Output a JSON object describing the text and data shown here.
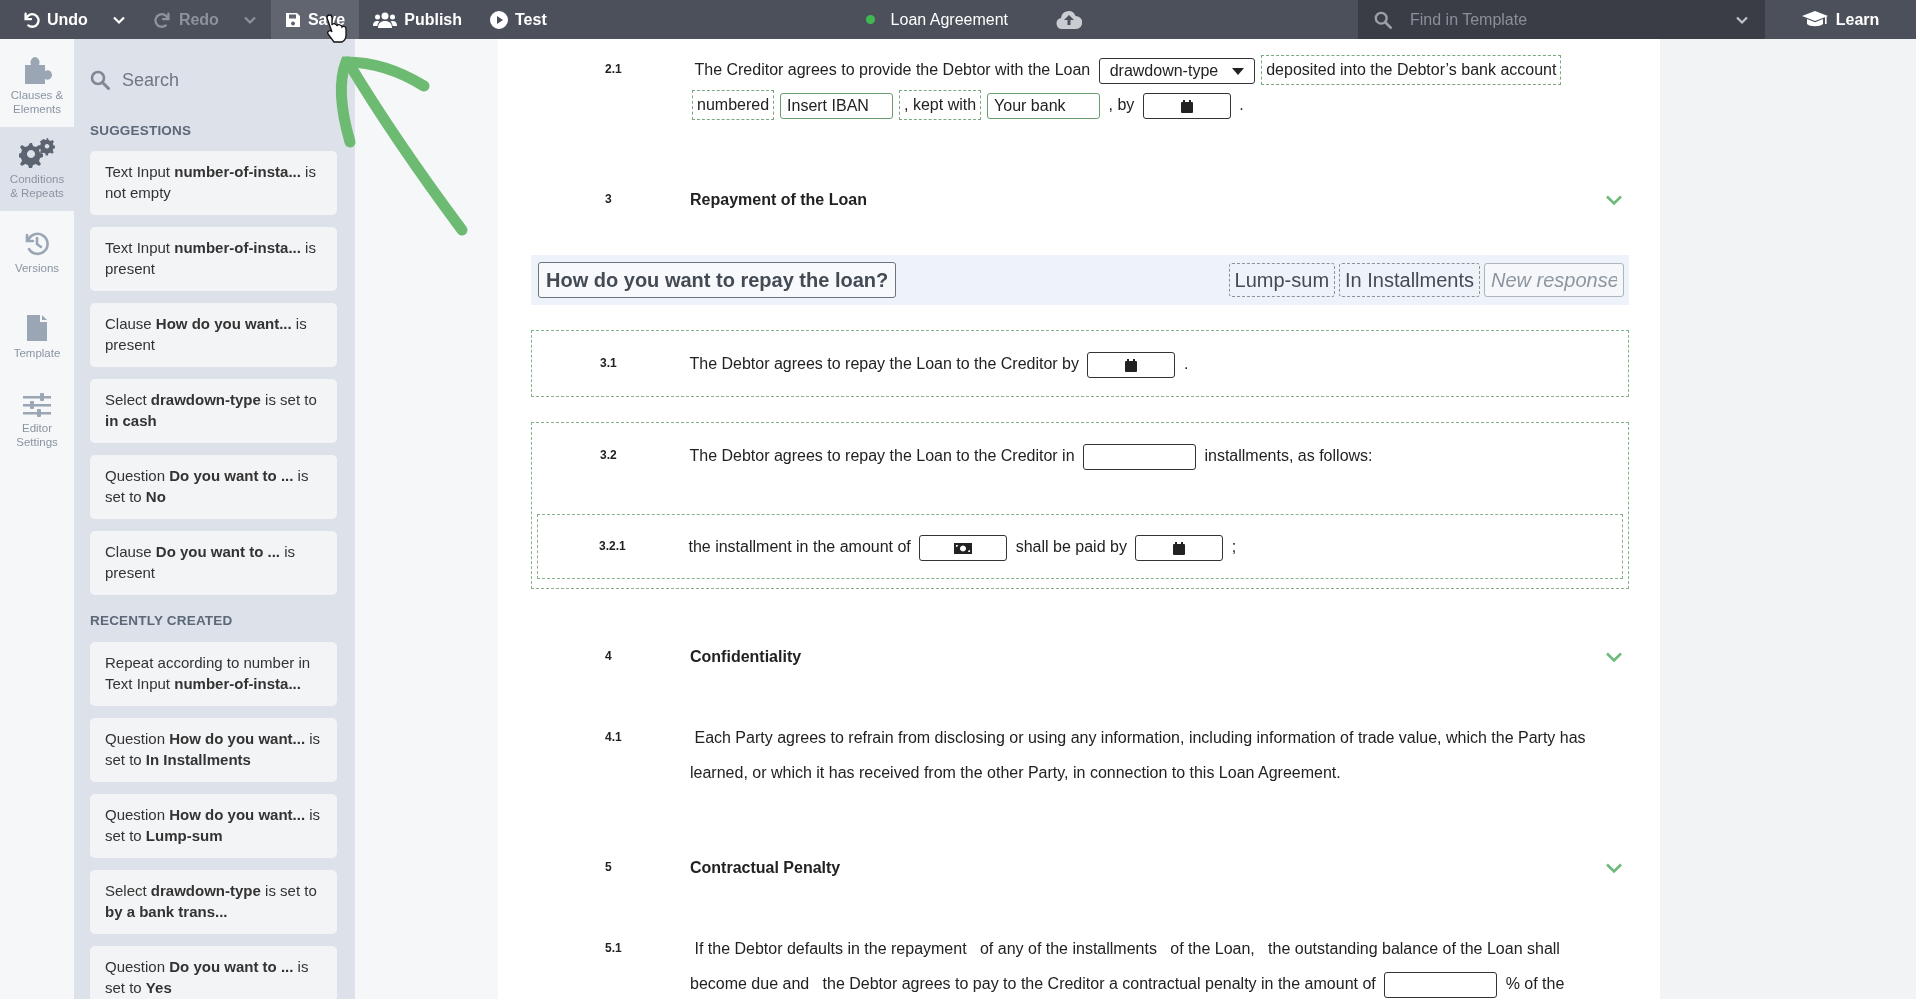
{
  "toolbar": {
    "buttons": [
      {
        "kind": "undo",
        "label": "Undo",
        "disabled": false,
        "highlighted": false,
        "has_menu": true
      },
      {
        "kind": "redo",
        "label": "Redo",
        "disabled": true,
        "highlighted": false,
        "has_menu": true
      },
      {
        "kind": "save",
        "label": "Save",
        "disabled": false,
        "highlighted": true,
        "has_menu": false
      },
      {
        "kind": "publish",
        "label": "Publish",
        "disabled": false,
        "highlighted": false,
        "has_menu": false
      },
      {
        "kind": "test",
        "label": "Test",
        "disabled": false,
        "highlighted": false,
        "has_menu": false
      }
    ]
  },
  "document_title": {
    "text": "Loan Agreement",
    "synced": true
  },
  "find": {
    "placeholder": "Find in Template"
  },
  "learn": {
    "label": "Learn"
  },
  "rail": [
    {
      "kind": "puzzle",
      "label": "Clauses & Elements",
      "selected": false
    },
    {
      "kind": "gears",
      "label": "Conditions & Repeats",
      "selected": true
    },
    {
      "kind": "history",
      "label": "Versions",
      "selected": false
    },
    {
      "kind": "file",
      "label": "Template",
      "selected": false
    },
    {
      "kind": "sliders",
      "label": "Editor Settings",
      "selected": false
    }
  ],
  "panel": {
    "search_placeholder": "Search",
    "sections": [
      {
        "title": "SUGGESTIONS",
        "items": [
          "Text Input **number-of-insta...** is not empty",
          "Text Input **number-of-insta...** is present",
          "Clause **How do you want...** is present",
          "Select **drawdown-type** is set to **in cash**",
          "Question **Do you want to ...** is set to **No**",
          "Clause **Do you want to ...** is present"
        ]
      },
      {
        "title": "RECENTLY CREATED",
        "items": [
          "Repeat according to number in Text Input **number-of-insta...**",
          "Question **How do you want...** is set to **In Installments**",
          "Question **How do you want...** is set to **Lump-sum**",
          "Select **drawdown-type** is set to **by a bank trans...**",
          "Question **Do you want to ...** is set to **Yes**"
        ]
      }
    ]
  },
  "document": {
    "blocks": [
      {
        "kind": "clause",
        "number": "2.1",
        "parts": [
          {
            "kind": "text",
            "text": "The Creditor agrees to provide the Debtor with the Loan"
          },
          {
            "kind": "select",
            "value": "drawdown-type"
          },
          {
            "kind": "condition-text",
            "text": "deposited into the Debtor’s bank account"
          },
          {
            "kind": "condition-text",
            "text": "numbered"
          },
          {
            "kind": "input",
            "value": "Insert IBAN"
          },
          {
            "kind": "condition-text",
            "text": ", kept with"
          },
          {
            "kind": "input",
            "value": "Your bank"
          },
          {
            "kind": "text",
            "text": ", by"
          },
          {
            "kind": "date"
          },
          {
            "kind": "text",
            "text": "."
          }
        ]
      },
      {
        "kind": "heading",
        "number": "3",
        "title": "Repayment of the Loan",
        "expanded": true
      },
      {
        "kind": "question",
        "text": "How do you want to repay the loan?",
        "responses": [
          {
            "label": "Lump-sum"
          },
          {
            "label": "In Installments"
          }
        ],
        "new_response_placeholder": "New response"
      },
      {
        "kind": "group",
        "children": [
          {
            "kind": "clause",
            "number": "3.1",
            "parts": [
              {
                "kind": "text",
                "text": "The Debtor agrees to repay the Loan to the Creditor by"
              },
              {
                "kind": "date"
              },
              {
                "kind": "text",
                "text": "."
              }
            ]
          }
        ]
      },
      {
        "kind": "group",
        "children": [
          {
            "kind": "clause",
            "number": "3.2",
            "parts": [
              {
                "kind": "text",
                "text": "The Debtor agrees to repay the Loan to the Creditor in"
              },
              {
                "kind": "input"
              },
              {
                "kind": "text",
                "text": "installments, as follows:"
              }
            ]
          },
          {
            "kind": "group",
            "children": [
              {
                "kind": "clause",
                "number": "3.2.1",
                "parts": [
                  {
                    "kind": "text",
                    "text": "the installment in the amount of"
                  },
                  {
                    "kind": "amount"
                  },
                  {
                    "kind": "text",
                    "text": "shall be paid by"
                  },
                  {
                    "kind": "date"
                  },
                  {
                    "kind": "text",
                    "text": ";"
                  }
                ]
              }
            ]
          }
        ]
      },
      {
        "kind": "heading",
        "number": "4",
        "title": "Confidentiality",
        "expanded": true
      },
      {
        "kind": "clause",
        "number": "4.1",
        "parts": [
          {
            "kind": "text",
            "text": "Each Party agrees to refrain from disclosing or using any information, including information of trade value, which the Party has learned, or which it has received from the other Party, in connection to this Loan Agreement."
          }
        ]
      },
      {
        "kind": "heading",
        "number": "5",
        "title": "Contractual Penalty",
        "expanded": true
      },
      {
        "kind": "clause",
        "number": "5.1",
        "parts": [
          {
            "kind": "text",
            "text": "If the Debtor defaults in the repayment   of any of the installments   of the Loan,   the outstanding balance of the Loan shall become due and   the Debtor agrees to pay to the Creditor a contractual penalty in the amount of"
          },
          {
            "kind": "input"
          },
          {
            "kind": "text",
            "text": "% of the"
          }
        ]
      }
    ]
  },
  "annotations": {
    "arrow": true,
    "hand_cursor": true
  }
}
